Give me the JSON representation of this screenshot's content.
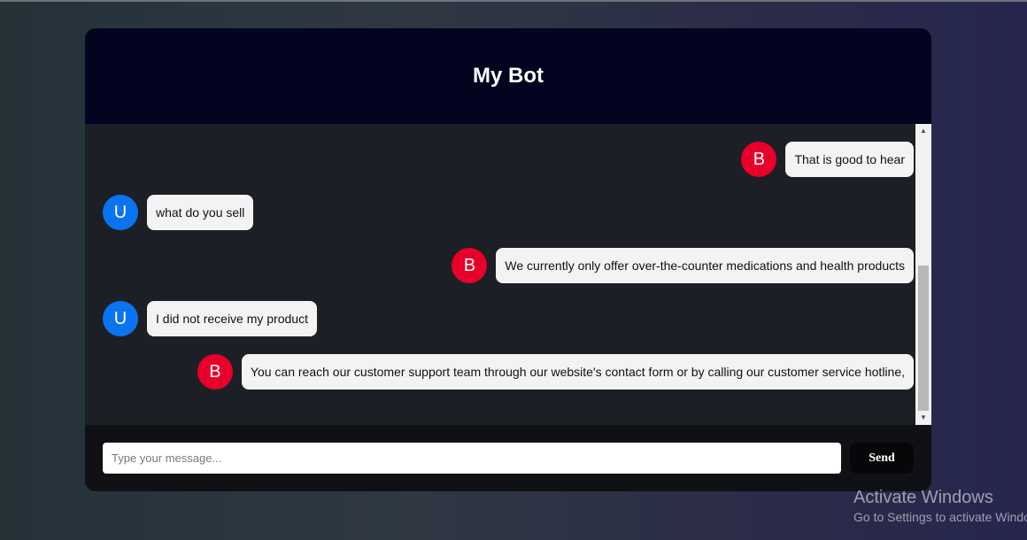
{
  "chat": {
    "title": "My Bot",
    "messages": [
      {
        "sender": "bot",
        "avatar": "B",
        "text": "That is good to hear"
      },
      {
        "sender": "user",
        "avatar": "U",
        "text": "what do you sell"
      },
      {
        "sender": "bot",
        "avatar": "B",
        "text": "We currently only offer over-the-counter medications and health products"
      },
      {
        "sender": "user",
        "avatar": "U",
        "text": "I did not receive my product"
      },
      {
        "sender": "bot",
        "avatar": "B",
        "text": "You can reach our customer support team through our website's contact form or by calling our customer service hotline,"
      }
    ]
  },
  "input": {
    "placeholder": "Type your message...",
    "value": ""
  },
  "send": {
    "label": "Send"
  },
  "scrollbar": {
    "up_icon": "scroll-up-arrow-icon",
    "down_icon": "scroll-down-arrow-icon"
  },
  "watermark": {
    "title": "Activate Windows",
    "subtitle": "Go to Settings to activate Windows."
  },
  "colors": {
    "header_bg": "#020420",
    "bot_avatar": "#e8002a",
    "user_avatar": "#0a74f0",
    "bubble_bg": "#f3f3f3"
  }
}
